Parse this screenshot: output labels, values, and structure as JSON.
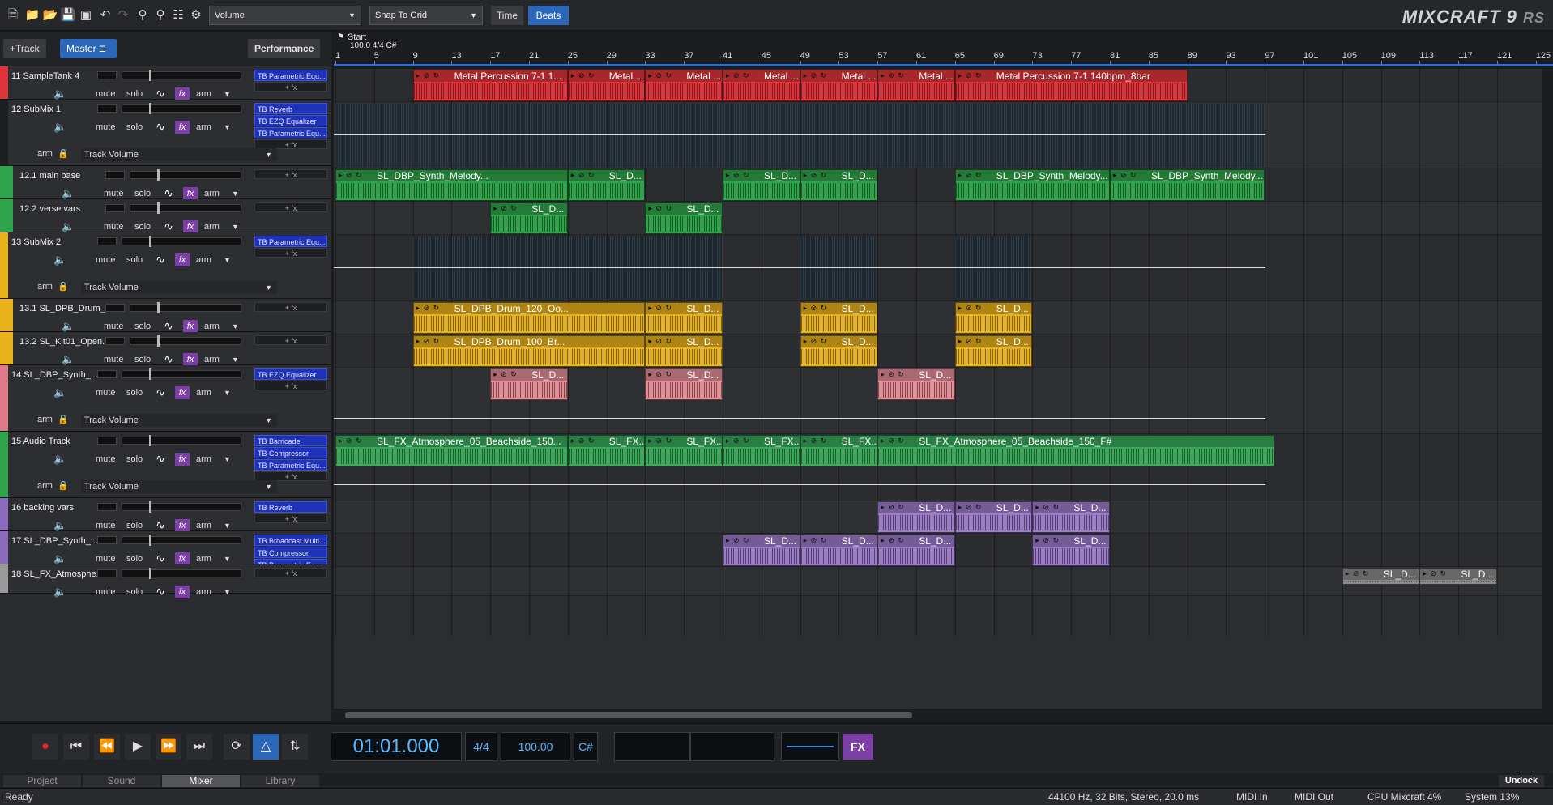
{
  "toolbar": {
    "icons": [
      "new-file-icon",
      "open-icon",
      "open-recent-icon",
      "save-icon",
      "save-as-icon",
      "undo-icon",
      "redo-icon",
      "zoom-in-icon",
      "zoom-out-icon",
      "mixer-icon",
      "view-icon",
      "settings-icon"
    ],
    "volume_label": "Volume",
    "snap_label": "Snap To Grid",
    "time_label": "Time",
    "beats_label": "Beats",
    "logo_main": "MIXCRAFT 9",
    "logo_suffix": "RS"
  },
  "row2": {
    "add_track": "+Track",
    "master": "Master",
    "performance": "Performance",
    "start_marker": "Start",
    "tempo_info": "100.0 4/4 C#"
  },
  "ruler": [
    "1",
    "5",
    "9",
    "13",
    "17",
    "21",
    "25",
    "29",
    "33",
    "37",
    "41",
    "45",
    "49",
    "53",
    "57",
    "61",
    "65",
    "69",
    "73",
    "77",
    "81",
    "85",
    "89",
    "93",
    "97",
    "101",
    "105",
    "109",
    "113",
    "117",
    "121",
    "125"
  ],
  "controls": {
    "mute": "mute",
    "solo": "solo",
    "arm": "arm",
    "fx": "fx",
    "plus_fx": "+ fx",
    "track_volume": "Track Volume"
  },
  "tracks": [
    {
      "name": "11 SampleTank 4",
      "plugins": [
        "TB Parametric Equ..."
      ],
      "color": "#e0343c"
    },
    {
      "name": "12 SubMix 1",
      "plugins": [
        "TB Reverb",
        "TB EZQ Equalizer",
        "TB Parametric Equ..."
      ],
      "color": "#1e1f22"
    },
    {
      "name": "12.1 main base",
      "plugins": [],
      "color": "#2fa44a"
    },
    {
      "name": "12.2 verse vars",
      "plugins": [],
      "color": "#2fa44a"
    },
    {
      "name": "13 SubMix 2",
      "plugins": [
        "TB Parametric Equ..."
      ],
      "color": "#e8b21c"
    },
    {
      "name": "13.1 SL_DPB_Drum_...",
      "plugins": [],
      "color": "#e8b21c"
    },
    {
      "name": "13.2 SL_Kit01_Open...",
      "plugins": [],
      "color": "#e8b21c"
    },
    {
      "name": "14 SL_DBP_Synth_...",
      "plugins": [
        "TB EZQ Equalizer"
      ],
      "color": "#e07a8a"
    },
    {
      "name": "15 Audio Track",
      "plugins": [
        "TB Barricade",
        "TB Compressor",
        "TB Parametric Equ..."
      ],
      "color": "#2fa44a"
    },
    {
      "name": "16 backing vars",
      "plugins": [
        "TB Reverb"
      ],
      "color": "#8a6bbd"
    },
    {
      "name": "17 SL_DBP_Synth_...",
      "plugins": [
        "TB Broadcast Multi...",
        "TB Compressor",
        "TB Parametric Equ..."
      ],
      "color": "#8a6bbd"
    },
    {
      "name": "18 SL_FX_Atmosphe...",
      "plugins": [],
      "color": "#9a9a9a"
    }
  ],
  "clips": {
    "metal_full": "Metal Percussion 7-1 1...",
    "metal_short": "Metal ...",
    "metal_last": "Metal Percussion 7-1 140bpm_8bar",
    "synth_melody": "SL_DBP_Synth_Melody...",
    "sl_d": "SL_D...",
    "drum_120": "SL_DPB_Drum_120_Oo...",
    "drum_100": "SL_DPB_Drum_100_Br...",
    "fx_atmos": "SL_FX_Atmosphere_05_Beachside_150...",
    "fx_short": "SL_FX...",
    "fx_atmos_full": "SL_FX_Atmosphere_05_Beachside_150_F#"
  },
  "transport": {
    "time": "01:01.000",
    "signature": "4/4",
    "tempo": "100.00",
    "key": "C#",
    "fx": "FX"
  },
  "tabs": [
    "Project",
    "Sound",
    "Mixer",
    "Library"
  ],
  "undock": "Undock",
  "status": {
    "ready": "Ready",
    "audio_info": "44100 Hz, 32 Bits, Stereo, 20.0 ms",
    "midi_in": "MIDI In",
    "midi_out": "MIDI Out",
    "cpu": "CPU Mixcraft 4%",
    "system": "System 13%"
  }
}
